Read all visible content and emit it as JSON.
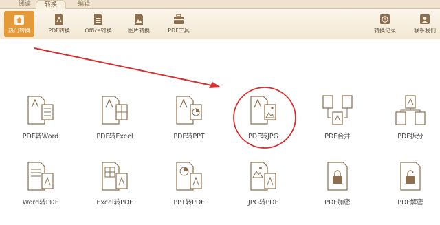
{
  "tabs": {
    "read": "阅读",
    "convert": "转换",
    "edit": "编辑"
  },
  "toolbar": {
    "hot": "热门转换",
    "pdf": "PDF转换",
    "office": "Office转换",
    "image": "图片转换",
    "tools": "PDF工具",
    "history": "转换记录",
    "contact": "联系我们"
  },
  "items": {
    "pdf_word": "PDF转Word",
    "pdf_excel": "PDF转Excel",
    "pdf_ppt": "PDF转PPT",
    "pdf_jpg": "PDF转JPG",
    "pdf_merge": "PDF合并",
    "pdf_split": "PDF拆分",
    "word_pdf": "Word转PDF",
    "excel_pdf": "Excel转PDF",
    "ppt_pdf": "PPT转PDF",
    "jpg_pdf": "JPG转PDF",
    "pdf_encrypt": "PDF加密",
    "pdf_decrypt": "PDF解密"
  },
  "colors": {
    "accent": "#e59a3a",
    "icon": "#8b6f4e",
    "annotation_red": "#d63030"
  }
}
